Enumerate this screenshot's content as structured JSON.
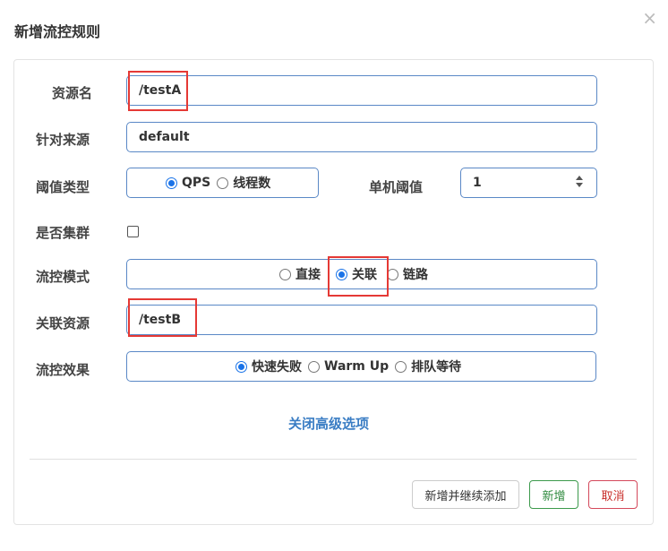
{
  "dialog": {
    "title": "新增流控规则",
    "close_label": "×"
  },
  "form": {
    "resource_label": "资源名",
    "resource_value": "/testA",
    "source_label": "针对来源",
    "source_value": "default",
    "threshold_type_label": "阈值类型",
    "threshold_type_options": [
      "QPS",
      "线程数"
    ],
    "threshold_type_selected": "QPS",
    "single_threshold_label": "单机阈值",
    "single_threshold_value": "1",
    "cluster_label": "是否集群",
    "cluster_checked": false,
    "flow_mode_label": "流控模式",
    "flow_mode_options": [
      "直接",
      "关联",
      "链路"
    ],
    "flow_mode_selected": "关联",
    "related_resource_label": "关联资源",
    "related_resource_value": "/testB",
    "effect_label": "流控效果",
    "effect_options": [
      "快速失败",
      "Warm Up",
      "排队等待"
    ],
    "effect_selected": "快速失败",
    "advanced_toggle": "关闭高级选项"
  },
  "footer": {
    "add_continue_label": "新增并继续添加",
    "add_label": "新增",
    "cancel_label": "取消"
  },
  "colors": {
    "accent": "#1a73e8",
    "link": "#3a7dc4",
    "highlight": "#e53935",
    "success": "#2f8a3f",
    "danger": "#c9302c"
  }
}
